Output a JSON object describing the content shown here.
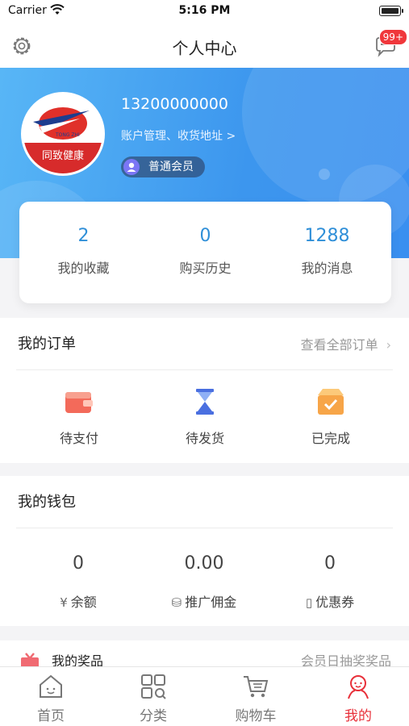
{
  "status_bar": {
    "carrier": "Carrier",
    "time": "5:16 PM"
  },
  "nav": {
    "title": "个人中心",
    "message_badge": "99+"
  },
  "profile": {
    "avatar_text": "同致健康",
    "avatar_sub": "TONG ZHI",
    "phone": "13200000000",
    "account_link": "账户管理、收货地址 >",
    "member_level": "普通会员"
  },
  "stats": [
    {
      "value": "2",
      "label": "我的收藏"
    },
    {
      "value": "0",
      "label": "购买历史"
    },
    {
      "value": "1288",
      "label": "我的消息"
    }
  ],
  "orders": {
    "title": "我的订单",
    "more": "查看全部订单",
    "items": [
      {
        "label": "待支付",
        "icon": "wallet-icon"
      },
      {
        "label": "待发货",
        "icon": "hourglass-icon"
      },
      {
        "label": "已完成",
        "icon": "check-box-icon"
      }
    ]
  },
  "wallet": {
    "title": "我的钱包",
    "items": [
      {
        "value": "0",
        "label": "余额",
        "icon": "¥"
      },
      {
        "value": "0.00",
        "label": "推广佣金",
        "icon": "coins-icon"
      },
      {
        "value": "0",
        "label": "优惠券",
        "icon": "coupon-icon"
      }
    ]
  },
  "prizes": {
    "title": "我的奖品",
    "more": "会员日抽奖奖品"
  },
  "tabs": [
    {
      "label": "首页",
      "icon": "home-icon"
    },
    {
      "label": "分类",
      "icon": "category-icon"
    },
    {
      "label": "购物车",
      "icon": "cart-icon"
    },
    {
      "label": "我的",
      "icon": "profile-icon"
    }
  ],
  "colors": {
    "accent": "#e8303a",
    "brand_blue": "#3c96ee",
    "stat_blue": "#2f8fd8"
  }
}
